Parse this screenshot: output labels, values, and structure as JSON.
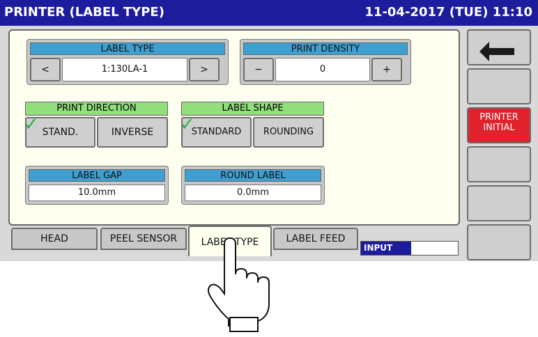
{
  "title": "PRINTER (LABEL TYPE)",
  "datetime": "11-04-2017 (TUE)  11:10",
  "label_type": {
    "header": "LABEL TYPE",
    "value": "1:130LA-1",
    "prev": "<",
    "next": ">"
  },
  "print_density": {
    "header": "PRINT DENSITY",
    "value": "0",
    "minus": "−",
    "plus": "+"
  },
  "print_direction": {
    "header": "PRINT DIRECTION",
    "options": [
      "STAND.",
      "INVERSE"
    ],
    "selected": "STAND."
  },
  "label_shape": {
    "header": "LABEL SHAPE",
    "options": [
      "STANDARD",
      "ROUNDING"
    ],
    "selected": "STANDARD"
  },
  "label_gap": {
    "header": "LABEL GAP",
    "value": "10.0mm"
  },
  "round_label": {
    "header": "ROUND LABEL",
    "value": "0.0mm"
  },
  "tabs": [
    "HEAD",
    "PEEL SENSOR",
    "LABEL TYPE",
    "LABEL FEED"
  ],
  "active_tab": "LABEL TYPE",
  "input_label": "INPUT",
  "side": {
    "printer_initial_line1": "PRINTER",
    "printer_initial_line2": "INITIAL"
  },
  "colors": {
    "titlebar": "#1c1c9c",
    "header_blue": "#3f9fd0",
    "header_green": "#92dd7c",
    "red_button": "#e0222c"
  },
  "icons": {
    "back": "return-arrow-icon",
    "check": "checkmark-icon",
    "hand": "tapping-hand-icon"
  }
}
